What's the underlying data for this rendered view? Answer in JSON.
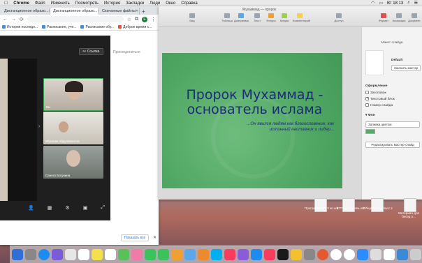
{
  "menubar": {
    "apple": "",
    "items": [
      "Chrome",
      "Файл",
      "Изменить",
      "Посмотреть",
      "История",
      "Закладки",
      "Люди",
      "Окно",
      "Справка"
    ],
    "status": {
      "day_time": "Вт 18:13"
    }
  },
  "chrome": {
    "tabs": [
      {
        "label": "Дистанционное образо..."
      },
      {
        "label": "Дистанционное образо..."
      },
      {
        "label": "Скачанные файлы"
      }
    ],
    "new_tab": "+",
    "address_url": "",
    "bookmarks": [
      "История исследо...",
      "Расписание, уче...",
      "Расписание обу...",
      "Доброе время с..."
    ],
    "profile_initial": "E"
  },
  "zoom": {
    "copy_link_label": "Ссылка",
    "participants_label": "Присоединиться",
    "participants": [
      {
        "name": "Вы"
      },
      {
        "name": "Ибрагим Абдулвахитов"
      },
      {
        "name": "Саннга Богунина"
      }
    ],
    "show_all_label": "Показать все"
  },
  "keynote": {
    "doc_title": "Мухаммад — пророк",
    "toolbar": [
      "Вид",
      "Таблица",
      "Диаграмма",
      "Текст",
      "Фигура",
      "Медиа",
      "Комментарий",
      "Доступ",
      "Формат",
      "Анимация",
      "Документ"
    ],
    "slide": {
      "title": "Пророк Мухаммад - основатель ислама",
      "subtitle": "...Он явился людям как благословение, как истинный наставник и лидер..."
    },
    "panel": {
      "header": "Макет слайда",
      "layout_name": "Default",
      "change_master": "Сменить мастер",
      "appearance": "Оформление",
      "options": [
        {
          "label": "Заголовок",
          "checked": false
        },
        {
          "label": "Текстовый блок",
          "checked": true
        },
        {
          "label": "Номер слайда",
          "checked": false
        }
      ],
      "background": "Фон",
      "fill": "Заливка цветом",
      "edit_master": "Редактировать мастер-слайд"
    }
  },
  "desktop": {
    "files": [
      {
        "label": "Программа ВР 3 кл.odt"
      },
      {
        "label": "КТП Рвят 5 каж.odt"
      },
      {
        "label": "Общество 6 класс 2"
      },
      {
        "label": "Материал для бесед п..."
      }
    ]
  },
  "colors": {
    "slide_green": "#4fa662",
    "slide_text": "#1c2c7a",
    "zoom_active_border": "#2fa84f"
  }
}
